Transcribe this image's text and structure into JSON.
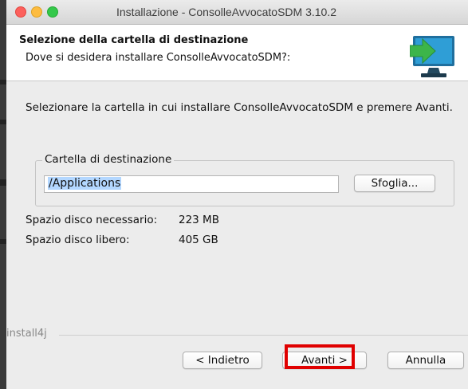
{
  "window": {
    "title": "Installazione - ConsolleAvvocatoSDM 3.10.2"
  },
  "header": {
    "title": "Selezione della cartella di destinazione",
    "subtitle": "Dove si desidera installare ConsolleAvvocatoSDM?:",
    "icon": "monitor-install-icon"
  },
  "body": {
    "description": "Selezionare la cartella in cui installare ConsolleAvvocatoSDM e premere Avanti."
  },
  "destination": {
    "group_label": "Cartella di destinazione",
    "path_value": "/Applications",
    "browse_label": "Sfoglia..."
  },
  "disk": {
    "required_label": "Spazio disco necessario:",
    "required_value": "223 MB",
    "free_label": "Spazio disco libero:",
    "free_value": "405 GB"
  },
  "footer": {
    "brand": "install4j",
    "back_label": "< Indietro",
    "next_label": "Avanti >",
    "cancel_label": "Annulla"
  },
  "colors": {
    "highlight": "#e00000",
    "icon_screen": "#2f9ed6",
    "icon_arrow": "#3cb54a",
    "selection": "#b3d7ff"
  }
}
